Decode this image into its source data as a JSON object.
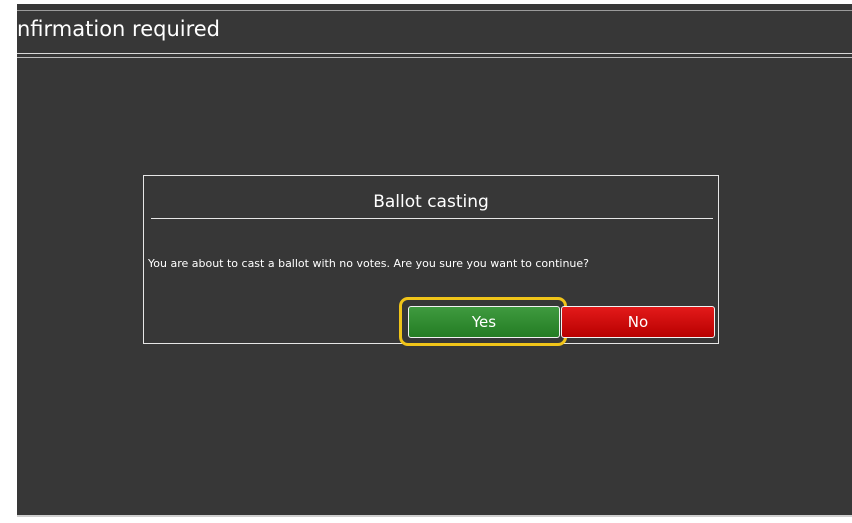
{
  "window": {
    "title": "nfirmation required"
  },
  "dialog": {
    "title": "Ballot casting",
    "message": "You are about to cast a ballot with no votes. Are you sure you want to continue?",
    "yes_label": "Yes",
    "no_label": "No"
  },
  "colors": {
    "background": "#373737",
    "yes_button": "#2e8b2e",
    "no_button": "#d00000",
    "highlight": "#f0c419",
    "text": "#ffffff"
  }
}
